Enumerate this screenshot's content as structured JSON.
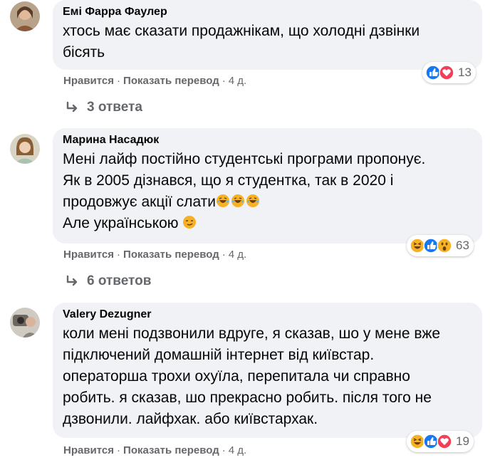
{
  "comments": [
    {
      "author": "Емі Фарра Фаулер",
      "lines": [
        "хтось має сказати продажнікам, що холодні дзвінки",
        "бісять"
      ],
      "reaction_icons": [
        "like-icon",
        "love-icon"
      ],
      "reaction_count": "13",
      "like_label": "Нравится",
      "translate_label": "Показать перевод",
      "time": "4 д.",
      "replies_label": "3 ответа"
    },
    {
      "author": "Марина Насадюк",
      "lines": [
        "Мені лайф постійно студентські програми пропонує.",
        "Як в 2005 дізнався, що я студентка, так в 2020 і",
        "продовжує акції слати",
        "Але українською "
      ],
      "reaction_icons": [
        "haha-icon",
        "like-icon",
        "wow-icon"
      ],
      "reaction_count": "63",
      "like_label": "Нравится",
      "translate_label": "Показать перевод",
      "time": "4 д.",
      "replies_label": "6 ответов"
    },
    {
      "author": "Valery Dezugner",
      "lines": [
        "коли мені подзвонили вдруге, я сказав, шо у мене вже",
        "підключений домашній інтернет від київстар.",
        "операторша трохи охуїла, перепитала чи справно",
        "робить. я сказав, шо прекрасно робить. після того не",
        "дзвонили. лайфхак. або київстархак."
      ],
      "reaction_icons": [
        "haha-icon",
        "like-icon",
        "love-icon"
      ],
      "reaction_count": "19",
      "like_label": "Нравится",
      "translate_label": "Показать перевод",
      "time": "4 д."
    }
  ],
  "separator": "·",
  "colors": {
    "bubble": "#f0f2f5",
    "secondary_text": "#65676b",
    "like_blue": "#1877f2",
    "love_red": "#f33e58",
    "haha_yellow": "#f7b125"
  }
}
